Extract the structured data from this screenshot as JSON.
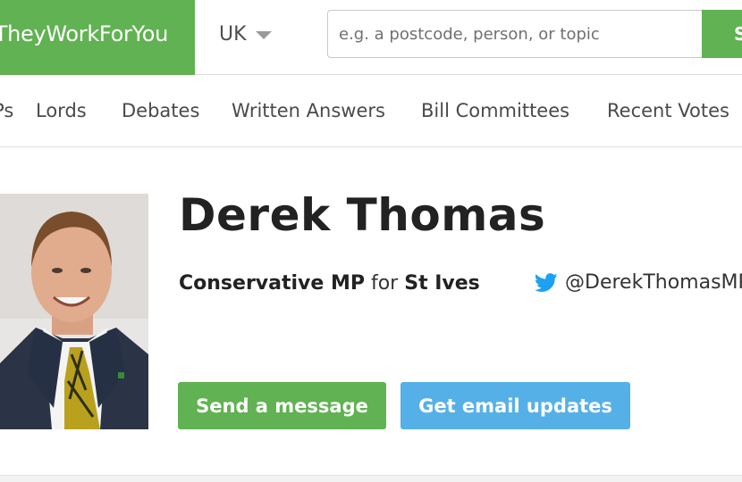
{
  "header": {
    "logo_text": "TheyWorkForYou",
    "country": "UK",
    "search_placeholder": "e.g. a postcode, person, or topic",
    "search_button": "Search",
    "brand_color": "#61b252"
  },
  "nav": {
    "items": [
      "MPs",
      "Lords",
      "Debates",
      "Written Answers",
      "Bill Committees",
      "Recent Votes"
    ]
  },
  "profile": {
    "name": "Derek Thomas",
    "party": "Conservative MP",
    "for_word": "for",
    "constituency": "St Ives",
    "twitter_handle": "@DerekThomasMP",
    "buttons": {
      "message": "Send a message",
      "email": "Get email updates"
    },
    "message_color": "#61b252",
    "email_color": "#56b0e8"
  },
  "icons": {
    "dropdown": "chevron-down-icon",
    "twitter": "twitter-bird-icon",
    "photo": "mp-portrait"
  }
}
